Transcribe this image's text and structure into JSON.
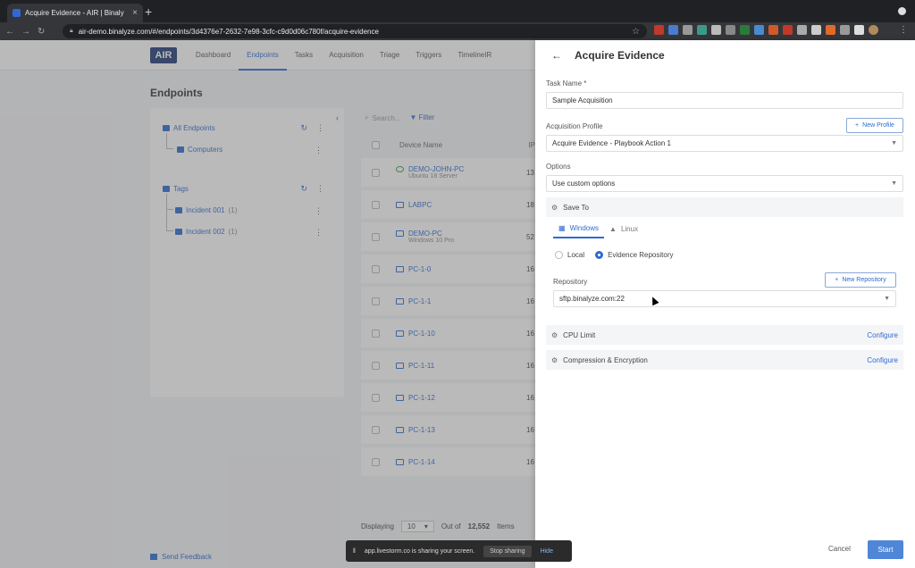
{
  "browser": {
    "tab_title": "Acquire Evidence - AIR | Binaly",
    "url": "air-demo.binalyze.com/#/endpoints/3d4376e7-2632-7e98-3cfc-c9d0d06c780f/acquire-evidence"
  },
  "app": {
    "logo": "AIR",
    "nav": [
      "Dashboard",
      "Endpoints",
      "Tasks",
      "Acquisition",
      "Triage",
      "Triggers",
      "TimelineIR"
    ],
    "page_title": "Endpoints",
    "tree": {
      "all_endpoints": "All Endpoints",
      "computers": "Computers",
      "tags": "Tags",
      "incident1": "Incident 001",
      "incident1_count": "(1)",
      "incident2": "Incident 002",
      "incident2_count": "(1)"
    },
    "search_placeholder": "Search...",
    "filter": "Filter",
    "col_device": "Device Name",
    "col_ip": "IP",
    "rows": [
      {
        "name": "DEMO-JOHN-PC",
        "sub": "Ubuntu 18 Server",
        "ip": "13"
      },
      {
        "name": "LABPC",
        "sub": "",
        "ip": "18"
      },
      {
        "name": "DEMO-PC",
        "sub": "Windows 10 Pro",
        "ip": "52"
      },
      {
        "name": "PC-1-0",
        "sub": "",
        "ip": "16"
      },
      {
        "name": "PC-1-1",
        "sub": "",
        "ip": "16"
      },
      {
        "name": "PC-1-10",
        "sub": "",
        "ip": "16"
      },
      {
        "name": "PC-1-11",
        "sub": "",
        "ip": "16"
      },
      {
        "name": "PC-1-12",
        "sub": "",
        "ip": "16"
      },
      {
        "name": "PC-1-13",
        "sub": "",
        "ip": "16"
      },
      {
        "name": "PC-1-14",
        "sub": "",
        "ip": "16"
      }
    ],
    "pager": {
      "displaying": "Displaying",
      "size": "10",
      "out_of": "Out of",
      "total": "12,552",
      "items": "Items"
    },
    "feedback": "Send Feedback"
  },
  "panel": {
    "title": "Acquire Evidence",
    "task_name_label": "Task Name *",
    "task_name_value": "Sample Acquisition",
    "profile_label": "Acquisition Profile",
    "new_profile": "New Profile",
    "profile_value": "Acquire Evidence - Playbook Action 1",
    "options_label": "Options",
    "options_value": "Use custom options",
    "save_to": "Save To",
    "tab_windows": "Windows",
    "tab_linux": "Linux",
    "radio_local": "Local",
    "radio_repo": "Evidence Repository",
    "repo_label": "Repository",
    "new_repo": "New Repository",
    "repo_value": "sftp.binalyze.com:22",
    "cpu_limit": "CPU Limit",
    "compression": "Compression & Encryption",
    "configure": "Configure",
    "cancel": "Cancel",
    "start": "Start"
  },
  "share_bar": {
    "text": "app.livestorm.co is sharing your screen.",
    "stop": "Stop sharing",
    "hide": "Hide"
  },
  "colors": {
    "accent": "#2e6bd2",
    "start": "#4f86d8",
    "dark_chrome": "#202124"
  }
}
